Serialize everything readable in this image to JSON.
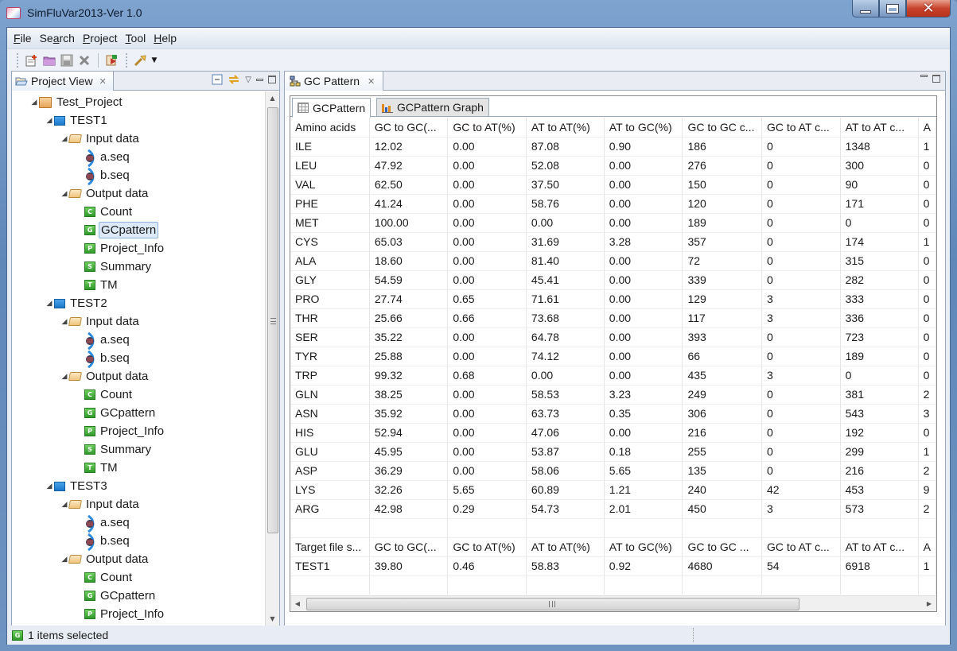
{
  "window": {
    "title": "SimFluVar2013-Ver 1.0",
    "controls": [
      "minimize",
      "maximize",
      "close"
    ]
  },
  "menubar": {
    "items": [
      {
        "label": "File",
        "mnemonic": "F"
      },
      {
        "label": "Search",
        "mnemonic": "a"
      },
      {
        "label": "Project",
        "mnemonic": "P"
      },
      {
        "label": "Tool",
        "mnemonic": "T"
      },
      {
        "label": "Help",
        "mnemonic": "H"
      }
    ]
  },
  "toolbar": {
    "buttons": [
      {
        "icon": "new-project-icon"
      },
      {
        "icon": "open-folder-icon"
      },
      {
        "icon": "save-icon"
      },
      {
        "icon": "delete-icon"
      },
      {
        "icon": "run-icon"
      },
      {
        "icon": "tool-dropdown-icon"
      }
    ]
  },
  "project_view": {
    "tab_label": "Project View",
    "tree": [
      {
        "level": 0,
        "type": "project",
        "label": "Test_Project",
        "expanded": true
      },
      {
        "level": 1,
        "type": "test",
        "label": "TEST1",
        "expanded": true
      },
      {
        "level": 2,
        "type": "folder",
        "label": "Input data",
        "expanded": true
      },
      {
        "level": 3,
        "type": "seq",
        "label": "a.seq"
      },
      {
        "level": 3,
        "type": "seq",
        "label": "b.seq"
      },
      {
        "level": 2,
        "type": "folder",
        "label": "Output data",
        "expanded": true
      },
      {
        "level": 3,
        "type": "file",
        "letter": "C",
        "label": "Count"
      },
      {
        "level": 3,
        "type": "file",
        "letter": "G",
        "label": "GCpattern",
        "selected": true
      },
      {
        "level": 3,
        "type": "file",
        "letter": "P",
        "label": "Project_Info"
      },
      {
        "level": 3,
        "type": "file",
        "letter": "S",
        "label": "Summary"
      },
      {
        "level": 3,
        "type": "file",
        "letter": "T",
        "label": "TM"
      },
      {
        "level": 1,
        "type": "test",
        "label": "TEST2",
        "expanded": true
      },
      {
        "level": 2,
        "type": "folder",
        "label": "Input data",
        "expanded": true
      },
      {
        "level": 3,
        "type": "seq",
        "label": "a.seq"
      },
      {
        "level": 3,
        "type": "seq",
        "label": "b.seq"
      },
      {
        "level": 2,
        "type": "folder",
        "label": "Output data",
        "expanded": true
      },
      {
        "level": 3,
        "type": "file",
        "letter": "C",
        "label": "Count"
      },
      {
        "level": 3,
        "type": "file",
        "letter": "G",
        "label": "GCpattern"
      },
      {
        "level": 3,
        "type": "file",
        "letter": "P",
        "label": "Project_Info"
      },
      {
        "level": 3,
        "type": "file",
        "letter": "S",
        "label": "Summary"
      },
      {
        "level": 3,
        "type": "file",
        "letter": "T",
        "label": "TM"
      },
      {
        "level": 1,
        "type": "test",
        "label": "TEST3",
        "expanded": true
      },
      {
        "level": 2,
        "type": "folder",
        "label": "Input data",
        "expanded": true
      },
      {
        "level": 3,
        "type": "seq",
        "label": "a.seq"
      },
      {
        "level": 3,
        "type": "seq",
        "label": "b.seq"
      },
      {
        "level": 2,
        "type": "folder",
        "label": "Output data",
        "expanded": true
      },
      {
        "level": 3,
        "type": "file",
        "letter": "C",
        "label": "Count"
      },
      {
        "level": 3,
        "type": "file",
        "letter": "G",
        "label": "GCpattern"
      },
      {
        "level": 3,
        "type": "file",
        "letter": "P",
        "label": "Project_Info"
      }
    ]
  },
  "editor": {
    "tab_label": "GC Pattern",
    "subtabs": [
      {
        "label": "GCPattern",
        "active": true
      },
      {
        "label": "GCPattern Graph",
        "active": false
      }
    ],
    "table": {
      "columns": [
        "Amino acids",
        "GC to GC(...",
        "GC to AT(%)",
        "AT to AT(%)",
        "AT to GC(%)",
        "GC to GC c...",
        "GC to AT c...",
        "AT to AT c...",
        "A"
      ],
      "rows": [
        [
          "ILE",
          "12.02",
          "0.00",
          "87.08",
          "0.90",
          "186",
          "0",
          "1348",
          "1"
        ],
        [
          "LEU",
          "47.92",
          "0.00",
          "52.08",
          "0.00",
          "276",
          "0",
          "300",
          "0"
        ],
        [
          "VAL",
          "62.50",
          "0.00",
          "37.50",
          "0.00",
          "150",
          "0",
          "90",
          "0"
        ],
        [
          "PHE",
          "41.24",
          "0.00",
          "58.76",
          "0.00",
          "120",
          "0",
          "171",
          "0"
        ],
        [
          "MET",
          "100.00",
          "0.00",
          "0.00",
          "0.00",
          "189",
          "0",
          "0",
          "0"
        ],
        [
          "CYS",
          "65.03",
          "0.00",
          "31.69",
          "3.28",
          "357",
          "0",
          "174",
          "1"
        ],
        [
          "ALA",
          "18.60",
          "0.00",
          "81.40",
          "0.00",
          "72",
          "0",
          "315",
          "0"
        ],
        [
          "GLY",
          "54.59",
          "0.00",
          "45.41",
          "0.00",
          "339",
          "0",
          "282",
          "0"
        ],
        [
          "PRO",
          "27.74",
          "0.65",
          "71.61",
          "0.00",
          "129",
          "3",
          "333",
          "0"
        ],
        [
          "THR",
          "25.66",
          "0.66",
          "73.68",
          "0.00",
          "117",
          "3",
          "336",
          "0"
        ],
        [
          "SER",
          "35.22",
          "0.00",
          "64.78",
          "0.00",
          "393",
          "0",
          "723",
          "0"
        ],
        [
          "TYR",
          "25.88",
          "0.00",
          "74.12",
          "0.00",
          "66",
          "0",
          "189",
          "0"
        ],
        [
          "TRP",
          "99.32",
          "0.68",
          "0.00",
          "0.00",
          "435",
          "3",
          "0",
          "0"
        ],
        [
          "GLN",
          "38.25",
          "0.00",
          "58.53",
          "3.23",
          "249",
          "0",
          "381",
          "2"
        ],
        [
          "ASN",
          "35.92",
          "0.00",
          "63.73",
          "0.35",
          "306",
          "0",
          "543",
          "3"
        ],
        [
          "HIS",
          "52.94",
          "0.00",
          "47.06",
          "0.00",
          "216",
          "0",
          "192",
          "0"
        ],
        [
          "GLU",
          "45.95",
          "0.00",
          "53.87",
          "0.18",
          "255",
          "0",
          "299",
          "1"
        ],
        [
          "ASP",
          "36.29",
          "0.00",
          "58.06",
          "5.65",
          "135",
          "0",
          "216",
          "2"
        ],
        [
          "LYS",
          "32.26",
          "5.65",
          "60.89",
          "1.21",
          "240",
          "42",
          "453",
          "9"
        ],
        [
          "ARG",
          "42.98",
          "0.29",
          "54.73",
          "2.01",
          "450",
          "3",
          "573",
          "2"
        ]
      ]
    },
    "summary_table": {
      "columns": [
        "Target file s...",
        "GC to GC(...",
        "GC to AT(%)",
        "AT to AT(%)",
        "AT to GC(%)",
        "GC to GC ...",
        "GC to AT c...",
        "AT to AT c...",
        "A"
      ],
      "rows": [
        [
          "TEST1",
          "39.80",
          "0.46",
          "58.83",
          "0.92",
          "4680",
          "54",
          "6918",
          "1"
        ]
      ]
    }
  },
  "statusbar": {
    "text": "1 items selected"
  }
}
